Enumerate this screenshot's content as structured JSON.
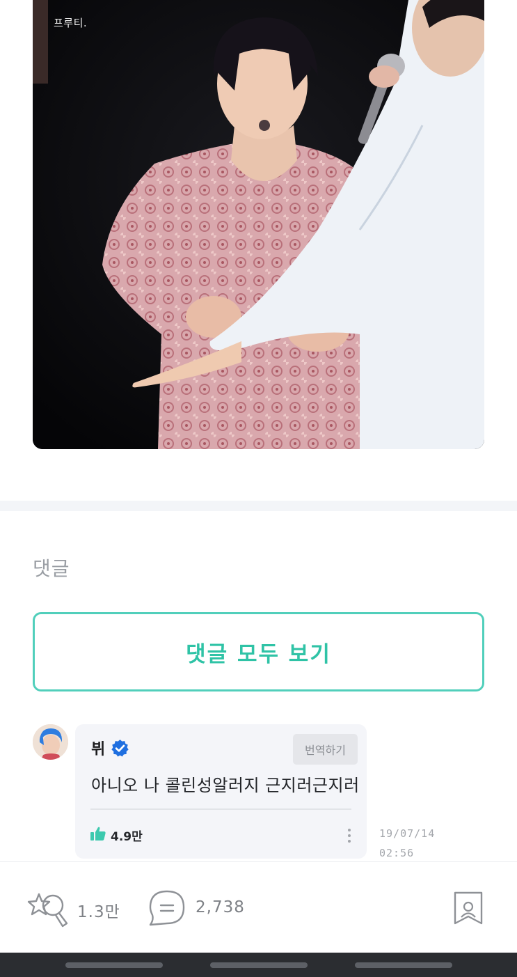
{
  "post": {
    "image_watermark": "프루티."
  },
  "comments_section": {
    "heading": "댓글",
    "view_all_label": "댓글 모두 보기"
  },
  "comment": {
    "author": "뷔",
    "author_verified_icon": "verified-badge-icon",
    "translate_label": "번역하기",
    "text": "아니오 나 콜린성알러지 근지러근지러",
    "likes": "4.9만",
    "date": "19/07/14",
    "time": "02:56"
  },
  "action_bar": {
    "likes_count": "1.3만",
    "comments_count": "2,738",
    "icons": [
      "star-wand-icon",
      "comment-bubble-icon",
      "bookmark-icon"
    ]
  },
  "colors": {
    "accent": "#2fc3a6",
    "accent_border": "#51cfbb",
    "verified_blue": "#1f6fe0",
    "nav_bar": "#2b2d31"
  }
}
